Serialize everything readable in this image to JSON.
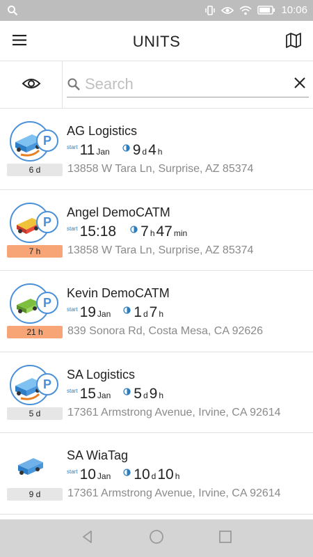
{
  "status_bar": {
    "time": "10:06",
    "icons": [
      "search-icon",
      "vibrate-icon",
      "eye-icon",
      "wifi-icon",
      "battery-icon"
    ]
  },
  "header": {
    "title": "UNITS",
    "left_icon": "menu-icon",
    "right_icon": "map-icon"
  },
  "search": {
    "placeholder": "Search",
    "value": ""
  },
  "units": [
    {
      "name": "AG Logistics",
      "start_label": "start",
      "start_value": "11",
      "start_unit": "Jan",
      "dur_1": "9",
      "dur_1_unit": "d",
      "dur_2": "4",
      "dur_2_unit": "h",
      "address": "13858 W Tara Ln, Surprise, AZ 85374",
      "badge": "6 d",
      "badge_color": "#e6e6e6",
      "icon": "blue-truck-icon",
      "parked": true
    },
    {
      "name": "Angel DemoCATM",
      "start_label": "start",
      "start_value": "15:18",
      "start_unit": "",
      "dur_1": "7",
      "dur_1_unit": "h",
      "dur_2": "47",
      "dur_2_unit": "min",
      "address": "13858 W Tara Ln, Surprise, AZ 85374",
      "badge": "7 h",
      "badge_color": "#f7a577",
      "icon": "red-truck-icon",
      "parked": true
    },
    {
      "name": "Kevin DemoCATM",
      "start_label": "start",
      "start_value": "19",
      "start_unit": "Jan",
      "dur_1": "1",
      "dur_1_unit": "d",
      "dur_2": "7",
      "dur_2_unit": "h",
      "address": "839 Sonora Rd, Costa Mesa, CA 92626",
      "badge": "21 h",
      "badge_color": "#f7a577",
      "icon": "green-truck-icon",
      "parked": true
    },
    {
      "name": "SA Logistics",
      "start_label": "start",
      "start_value": "15",
      "start_unit": "Jan",
      "dur_1": "5",
      "dur_1_unit": "d",
      "dur_2": "9",
      "dur_2_unit": "h",
      "address": "17361 Armstrong Avenue, Irvine, CA 92614",
      "badge": "5 d",
      "badge_color": "#e6e6e6",
      "icon": "blue-truck-icon",
      "parked": true
    },
    {
      "name": "SA WiaTag",
      "start_label": "start",
      "start_value": "10",
      "start_unit": "Jan",
      "dur_1": "10",
      "dur_1_unit": "d",
      "dur_2": "10",
      "dur_2_unit": "h",
      "address": "17361 Armstrong Avenue, Irvine, CA 92614",
      "badge": "9 d",
      "badge_color": "#e6e6e6",
      "icon": "blue-van-icon",
      "parked": false
    }
  ],
  "nav_bar": {
    "icons": [
      "back-icon",
      "home-icon",
      "recents-icon"
    ]
  },
  "colors": {
    "accent": "#4a90d9",
    "orange_badge": "#f7a577",
    "grey_badge": "#e6e6e6",
    "status_bar": "#bdbdbd"
  }
}
